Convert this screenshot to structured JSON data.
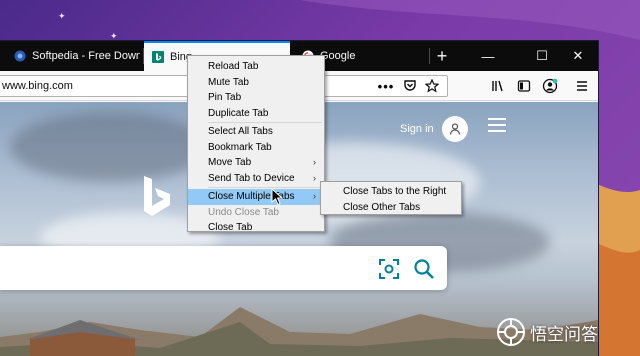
{
  "tabs": [
    {
      "title": "Softpedia - Free Down",
      "favicon": "softpedia-icon",
      "active": false
    },
    {
      "title": "Bing",
      "favicon": "bing-icon",
      "active": true
    },
    {
      "title": "Google",
      "favicon": "google-icon",
      "active": false
    }
  ],
  "new_tab": "+",
  "window_controls": {
    "minimize": "—",
    "maximize": "☐",
    "close": "✕"
  },
  "address": {
    "url": "www.bing.com"
  },
  "toolbar_icons": [
    "more-icon",
    "pocket-icon",
    "bookmark-star-icon",
    "library-icon",
    "sidebar-icon",
    "account-icon",
    "menu-icon"
  ],
  "page": {
    "signin_label": "Sign in"
  },
  "context_menu": {
    "items": [
      {
        "label": "Reload Tab",
        "disabled": false,
        "submenu": false
      },
      {
        "label": "Mute Tab",
        "disabled": false,
        "submenu": false
      },
      {
        "label": "Pin Tab",
        "disabled": false,
        "submenu": false
      },
      {
        "label": "Duplicate Tab",
        "disabled": false,
        "submenu": false
      },
      {
        "label": "Select All Tabs",
        "disabled": false,
        "submenu": false
      },
      {
        "label": "Bookmark Tab",
        "disabled": false,
        "submenu": false
      },
      {
        "label": "Move Tab",
        "disabled": false,
        "submenu": true
      },
      {
        "label": "Send Tab to Device",
        "disabled": false,
        "submenu": true
      },
      {
        "label": "Close Multiple Tabs",
        "disabled": false,
        "submenu": true,
        "highlighted": true
      },
      {
        "label": "Undo Close Tab",
        "disabled": true,
        "submenu": false
      },
      {
        "label": "Close Tab",
        "disabled": false,
        "submenu": false
      }
    ],
    "submenu_arrow": "›"
  },
  "submenu": {
    "items": [
      {
        "label": "Close Tabs to the Right"
      },
      {
        "label": "Close Other Tabs"
      }
    ]
  },
  "watermark": {
    "text": "悟空问答"
  },
  "colors": {
    "accent": "#0a84ff",
    "highlight": "#91c9f7",
    "tabstrip": "#0c0c0d"
  }
}
